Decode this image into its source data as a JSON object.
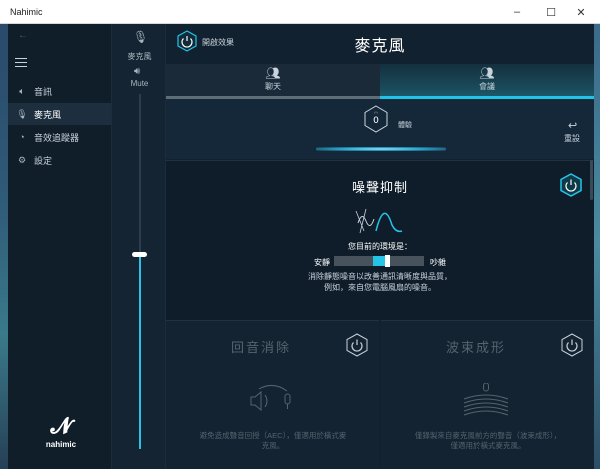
{
  "window": {
    "title": "Nahimic",
    "minimize": "–",
    "maximize": "☐",
    "close": "✕"
  },
  "nav": {
    "items": [
      {
        "label": "音訊",
        "icon": "speaker-icon"
      },
      {
        "label": "麥克風",
        "icon": "microphone-icon"
      },
      {
        "label": "音效追蹤器",
        "icon": "tracker-icon"
      },
      {
        "label": "設定",
        "icon": "gear-icon"
      }
    ],
    "active_index": 1,
    "logo_word": "nahimic"
  },
  "mic_column": {
    "mic_label": "麥克風",
    "mute_label": "Mute",
    "volume_level": 0.55
  },
  "header": {
    "power_label": "開啟效果",
    "title": "麥克風"
  },
  "tabs": [
    {
      "label": "聊天",
      "icon": "chat-people-icon"
    },
    {
      "label": "會議",
      "icon": "meeting-people-icon"
    }
  ],
  "active_tab": 1,
  "preset": {
    "value": "0",
    "label": "體驗",
    "reset_label": "重設"
  },
  "noise_reduction": {
    "title": "噪聲抑制",
    "environment_question": "您目前的環境是：",
    "quiet_label": "安靜",
    "noisy_label": "吵雜",
    "level": 0.5,
    "description": "消除靜態噪音以改善通訊清晰度與品質，例如，來自您電腦風扇的噪音。"
  },
  "echo_cancel": {
    "title": "回音消除",
    "description": "避免造成聲音回授（AEC），僅適用於橫式麥克風。"
  },
  "beamforming": {
    "title": "波束成形",
    "description": "僅錄製來自麥克風前方的聲音（波束成形），僅適用於橫式麥克風。"
  },
  "colors": {
    "accent": "#25c3e6",
    "background": "#122130",
    "disabled_text": "#56636e"
  }
}
